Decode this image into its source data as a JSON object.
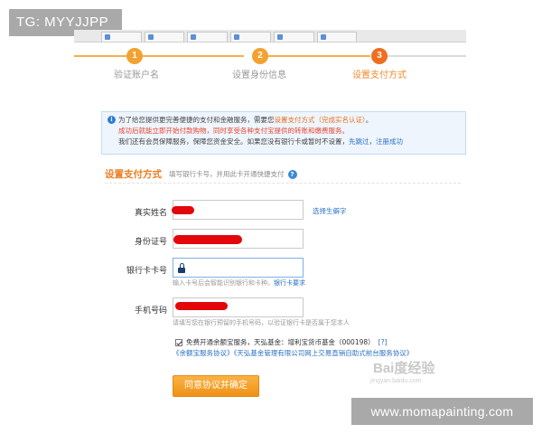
{
  "overlay": {
    "tg_badge": "TG: MYYJJPP",
    "site_badge": "www.momapainting.com",
    "baidu_watermark": "Bai度经验",
    "baidu_sub": "jingyan.baidu.com"
  },
  "browser_tabs": [
    "",
    "",
    "",
    "",
    "",
    ""
  ],
  "steps": [
    {
      "number": "1",
      "label": "验证账户名",
      "state": "done"
    },
    {
      "number": "2",
      "label": "设置身份信息",
      "state": "done"
    },
    {
      "number": "3",
      "label": "设置支付方式",
      "state": "current"
    }
  ],
  "notice": {
    "line1_a": "为了给您提供更完善便捷的支付和金融服务，需要您",
    "line1_b": "设置支付方式（完成实名认证）",
    "line1_c": "。",
    "line2": "成功后就能立即开始付款购物，同时享受各种支付宝提供的转账和缴费服务。",
    "line3_a": "我们还有会员保障服务，保障您资金安全。如果您没有银行卡或暂时不设置，",
    "line3_b": "先跳过",
    "line3_c": "，",
    "line3_d": "注册成功"
  },
  "section": {
    "title": "设置支付方式",
    "subtitle": "填写银行卡号，并用此卡开通快捷支付"
  },
  "form": {
    "name_label": "真实姓名",
    "name_link": "选择生僻字",
    "id_label": "身份证号",
    "card_label": "银行卡卡号",
    "card_hint_a": "输入卡号后会智能识别银行和卡种。",
    "card_hint_link": "银行卡要求",
    "phone_label": "手机号码",
    "phone_hint": "请填写您在银行预留的手机号码，以验证银行卡是否属于您本人"
  },
  "agreement": {
    "checked": true,
    "text": "免费开通余额宝服务，天弘基金：增利宝货币基金（000198）",
    "help": "[?]",
    "links": "《余额宝服务协议》《天弘基金管理有限公司网上交易直销自助式前台服务协议》"
  },
  "submit_label": "同意协议并确定",
  "colors": {
    "step": "#f3a231",
    "step_current": "#ee6f1f",
    "accent_orange": "#ee7a1c",
    "link_blue": "#2a70c4",
    "redaction": "#e3060b"
  }
}
